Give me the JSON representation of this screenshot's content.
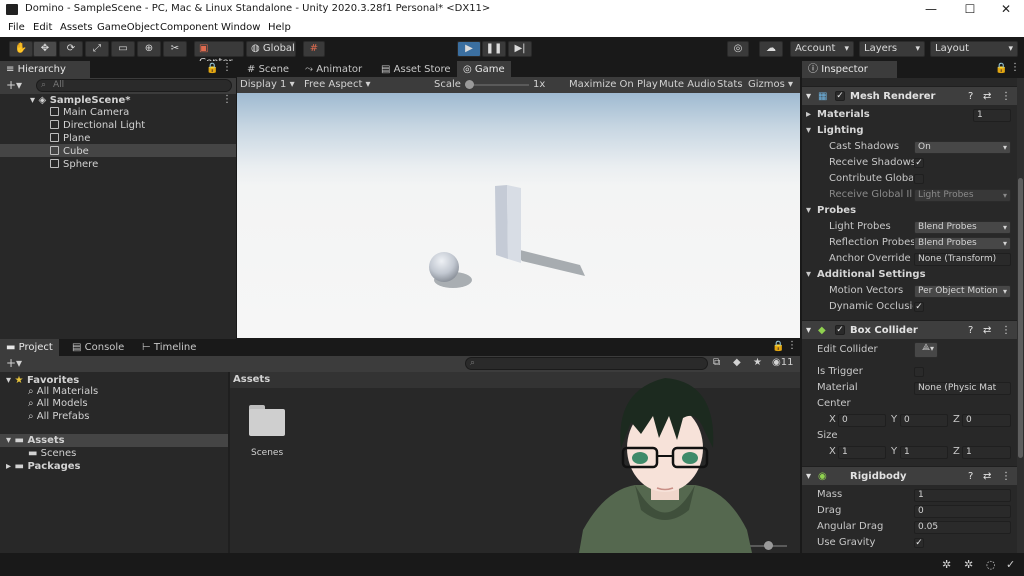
{
  "window": {
    "title": "Domino - SampleScene - PC, Mac & Linux Standalone - Unity 2020.3.28f1 Personal* <DX11>",
    "minimize": "—",
    "maximize": "☐",
    "close": "✕"
  },
  "menu": [
    "File",
    "Edit",
    "Assets",
    "GameObject",
    "Component",
    "Window",
    "Help"
  ],
  "toolbar": {
    "pivot": "Center",
    "space": "Global",
    "account": "Account",
    "layers": "Layers",
    "layout": "Layout"
  },
  "hierarchy": {
    "tab": "Hierarchy",
    "search_placeholder": "All",
    "scene": "SampleScene*",
    "items": [
      "Main Camera",
      "Directional Light",
      "Plane",
      "Cube",
      "Sphere"
    ]
  },
  "center_tabs": [
    "Scene",
    "Animator",
    "Asset Store",
    "Game"
  ],
  "game_bar": {
    "display": "Display 1",
    "aspect": "Free Aspect",
    "scale_label": "Scale",
    "scale_value": "1x",
    "maximize": "Maximize On Play",
    "mute": "Mute Audio",
    "stats": "Stats",
    "gizmos": "Gizmos"
  },
  "project": {
    "tabs": [
      "Project",
      "Console",
      "Timeline"
    ],
    "favorites": "Favorites",
    "favorite_items": [
      "All Materials",
      "All Models",
      "All Prefabs"
    ],
    "assets": "Assets",
    "scenes": "Scenes",
    "packages": "Packages",
    "assets_header": "Assets",
    "folder_label": "Scenes",
    "hidden_count": "11"
  },
  "inspector": {
    "tab": "Inspector",
    "mesh_renderer": {
      "title": "Mesh Renderer",
      "materials_label": "Materials",
      "materials_count": "1",
      "lighting": "Lighting",
      "cast_shadows_label": "Cast Shadows",
      "cast_shadows": "On",
      "receive_shadows_label": "Receive Shadows",
      "contribute_gi_label": "Contribute Global Il",
      "receive_gi_label": "Receive Global Illu",
      "receive_gi_value": "Light Probes",
      "probes": "Probes",
      "light_probes_label": "Light Probes",
      "light_probes": "Blend Probes",
      "reflection_probes_label": "Reflection Probes",
      "reflection_probes": "Blend Probes",
      "anchor_label": "Anchor Override",
      "anchor_value": "None (Transform)",
      "additional": "Additional Settings",
      "motion_label": "Motion Vectors",
      "motion_value": "Per Object Motion",
      "occlusion_label": "Dynamic Occlusion"
    },
    "box_collider": {
      "title": "Box Collider",
      "edit_label": "Edit Collider",
      "trigger_label": "Is Trigger",
      "material_label": "Material",
      "material_value": "None (Physic Mat",
      "center_label": "Center",
      "center": {
        "x": "0",
        "y": "0",
        "z": "0"
      },
      "size_label": "Size",
      "size": {
        "x": "1",
        "y": "1",
        "z": "1"
      }
    },
    "rigidbody": {
      "title": "Rigidbody",
      "mass_label": "Mass",
      "mass": "1",
      "drag_label": "Drag",
      "drag": "0",
      "angular_label": "Angular Drag",
      "angular": "0.05",
      "gravity_label": "Use Gravity"
    }
  },
  "axis_labels": {
    "x": "X",
    "y": "Y",
    "z": "Z"
  }
}
